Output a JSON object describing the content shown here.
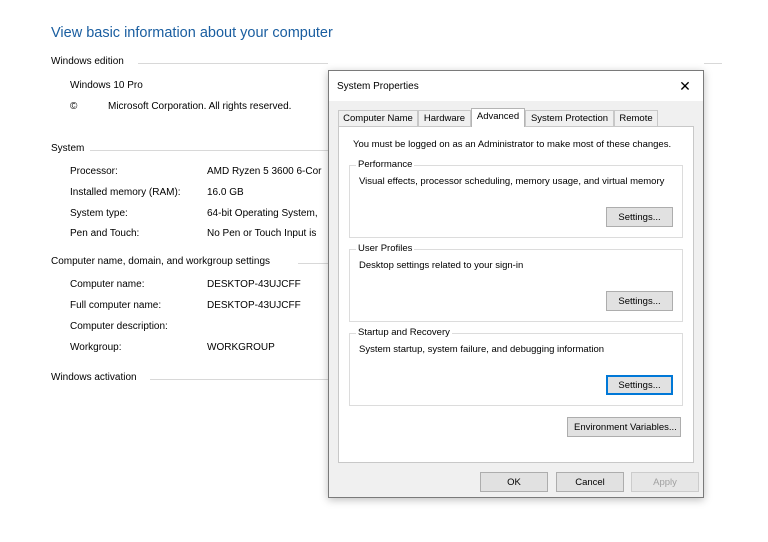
{
  "background": {
    "title": "View basic information about your computer",
    "windows_edition": {
      "header": "Windows edition",
      "edition": "Windows 10 Pro",
      "copyright_symbol": "©",
      "copyright_text": "Microsoft Corporation. All rights reserved."
    },
    "system": {
      "header": "System",
      "rows": [
        {
          "label": "Processor:",
          "value": "AMD Ryzen 5 3600 6-Cor"
        },
        {
          "label": "Installed memory (RAM):",
          "value": "16.0 GB"
        },
        {
          "label": "System type:",
          "value": "64-bit Operating System,"
        },
        {
          "label": "Pen and Touch:",
          "value": "No Pen or Touch Input is"
        }
      ]
    },
    "computer_name": {
      "header": "Computer name, domain, and workgroup settings",
      "rows": [
        {
          "label": "Computer name:",
          "value": "DESKTOP-43UJCFF"
        },
        {
          "label": "Full computer name:",
          "value": "DESKTOP-43UJCFF"
        },
        {
          "label": "Computer description:",
          "value": ""
        },
        {
          "label": "Workgroup:",
          "value": "WORKGROUP"
        }
      ]
    },
    "activation": {
      "header": "Windows activation"
    }
  },
  "dialog": {
    "title": "System Properties",
    "close_glyph": "✕",
    "tabs": [
      "Computer Name",
      "Hardware",
      "Advanced",
      "System Protection",
      "Remote"
    ],
    "active_tab": "Advanced",
    "notice": "You must be logged on as an Administrator to make most of these changes.",
    "groups": {
      "performance": {
        "legend": "Performance",
        "description": "Visual effects, processor scheduling, memory usage, and virtual memory",
        "button": "Settings..."
      },
      "user_profiles": {
        "legend": "User Profiles",
        "description": "Desktop settings related to your sign-in",
        "button": "Settings..."
      },
      "startup_recovery": {
        "legend": "Startup and Recovery",
        "description": "System startup, system failure, and debugging information",
        "button": "Settings..."
      }
    },
    "env_button": "Environment Variables...",
    "ok": "OK",
    "cancel": "Cancel",
    "apply": "Apply"
  },
  "colors": {
    "title_link": "#1a5ea0",
    "focus_border": "#0078d7"
  }
}
